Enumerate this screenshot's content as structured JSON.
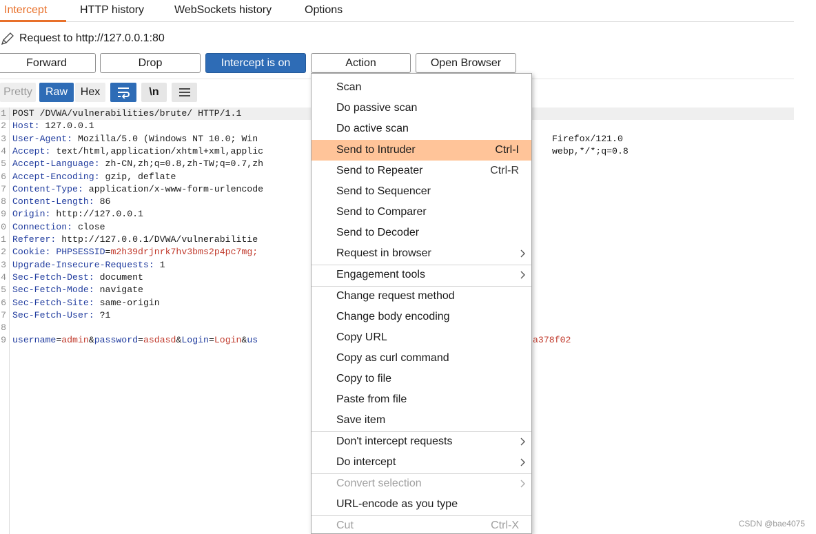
{
  "tabs": [
    "Intercept",
    "HTTP history",
    "WebSockets history",
    "Options"
  ],
  "request_line": "Request to http://127.0.0.1:80",
  "buttons": {
    "forward": "Forward",
    "drop": "Drop",
    "intercept": "Intercept is on",
    "action": "Action",
    "open_browser": "Open Browser"
  },
  "view_modes": {
    "pretty": "Pretty",
    "raw": "Raw",
    "hex": "Hex",
    "newline": "\\n"
  },
  "code": {
    "line1": "POST /DVWA/vulnerabilities/brute/ HTTP/1.1",
    "host_k": "Host:",
    "host_v": " 127.0.0.1",
    "ua_k": "User-Agent:",
    "ua_v": " Mozilla/5.0 (Windows NT 10.0; Win",
    "ua_tail": "Firefox/121.0",
    "accept_k": "Accept:",
    "accept_v": " text/html,application/xhtml+xml,applic",
    "accept_tail": "webp,*/*;q=0.8",
    "al_k": "Accept-Language:",
    "al_v": " zh-CN,zh;q=0.8,zh-TW;q=0.7,zh",
    "ae_k": "Accept-Encoding:",
    "ae_v": " gzip, deflate",
    "ct_k": "Content-Type:",
    "ct_v": " application/x-www-form-urlencode",
    "cl_k": "Content-Length:",
    "cl_v": " 86",
    "origin_k": "Origin:",
    "origin_v": " http://127.0.0.1",
    "conn_k": "Connection:",
    "conn_v": " close",
    "ref_k": "Referer:",
    "ref_v": " http://127.0.0.1/DVWA/vulnerabilitie",
    "cookie_k": "Cookie:",
    "cookie_name": " PHPSESSID",
    "cookie_eq": "=",
    "cookie_val": "m2h39drjnrk7hv3bms2p4pc7mg;",
    "uir_k": "Upgrade-Insecure-Requests:",
    "uir_v": " 1",
    "sfd_k": "Sec-Fetch-Dest:",
    "sfd_v": " document",
    "sfm_k": "Sec-Fetch-Mode:",
    "sfm_v": " navigate",
    "sfs_k": "Sec-Fetch-Site:",
    "sfs_v": " same-origin",
    "sfu_k": "Sec-Fetch-User:",
    "sfu_v": " ?1",
    "body_u_k": "username",
    "body_eq": "=",
    "body_u_v": "admin",
    "body_amp": "&",
    "body_p_k": "password",
    "body_p_v": "asdasd",
    "body_l_k": "Login",
    "body_l_v": "Login",
    "body_us": "us",
    "body_tail": "a378f02"
  },
  "line_numbers": [
    "1",
    "2",
    "3",
    "4",
    "5",
    "6",
    "7",
    "8",
    "9",
    "0",
    "1",
    "2",
    "3",
    "4",
    "5",
    "6",
    "7",
    "8",
    "9"
  ],
  "context_menu": [
    {
      "label": "Scan",
      "shortcut": ""
    },
    {
      "label": "Do passive scan",
      "shortcut": ""
    },
    {
      "label": "Do active scan",
      "shortcut": ""
    },
    {
      "label": "Send to Intruder",
      "shortcut": "Ctrl-I"
    },
    {
      "label": "Send to Repeater",
      "shortcut": "Ctrl-R"
    },
    {
      "label": "Send to Sequencer",
      "shortcut": ""
    },
    {
      "label": "Send to Comparer",
      "shortcut": ""
    },
    {
      "label": "Send to Decoder",
      "shortcut": ""
    },
    {
      "label": "Request in browser",
      "shortcut": ""
    },
    {
      "label": "Engagement tools",
      "shortcut": ""
    },
    {
      "label": "Change request method",
      "shortcut": ""
    },
    {
      "label": "Change body encoding",
      "shortcut": ""
    },
    {
      "label": "Copy URL",
      "shortcut": ""
    },
    {
      "label": "Copy as curl command",
      "shortcut": ""
    },
    {
      "label": "Copy to file",
      "shortcut": ""
    },
    {
      "label": "Paste from file",
      "shortcut": ""
    },
    {
      "label": "Save item",
      "shortcut": ""
    },
    {
      "label": "Don't intercept requests",
      "shortcut": ""
    },
    {
      "label": "Do intercept",
      "shortcut": ""
    },
    {
      "label": "Convert selection",
      "shortcut": ""
    },
    {
      "label": "URL-encode as you type",
      "shortcut": ""
    },
    {
      "label": "Cut",
      "shortcut": "Ctrl-X"
    }
  ],
  "colors": {
    "accent": "#e8702a",
    "primary": "#2e6cb6",
    "menu_hover": "#ffc499",
    "header_key": "#1f3b9e",
    "value_red": "#c0392b"
  },
  "watermark": "CSDN @bae4075"
}
